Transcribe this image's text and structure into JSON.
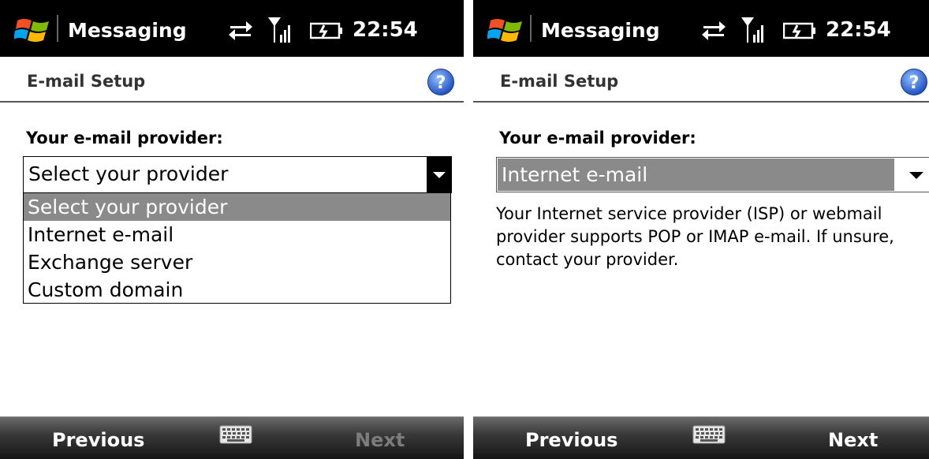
{
  "screens": [
    {
      "status_bar": {
        "app_title": "Messaging",
        "time": "22:54"
      },
      "header": {
        "title": "E-mail Setup"
      },
      "field_label": "Your e-mail provider:",
      "dropdown": {
        "value": "Select your provider",
        "expanded": true,
        "options": [
          "Select your provider",
          "Internet e-mail",
          "Exchange server",
          "Custom domain"
        ],
        "highlighted_option": "Select your provider"
      },
      "softkeys": {
        "left": "Previous",
        "right": "Next",
        "right_enabled": false
      }
    },
    {
      "status_bar": {
        "app_title": "Messaging",
        "time": "22:54"
      },
      "header": {
        "title": "E-mail Setup"
      },
      "field_label": "Your e-mail provider:",
      "dropdown": {
        "value": "Internet e-mail",
        "expanded": false
      },
      "description": "Your Internet service provider (ISP) or webmail provider supports POP or IMAP e-mail.  If unsure, contact your provider.",
      "softkeys": {
        "left": "Previous",
        "right": "Next",
        "right_enabled": true
      }
    }
  ],
  "colors": {
    "status_bar_bg": "#000000",
    "selection_gray": "#8a8a8a",
    "disabled_text": "#7c7c7c",
    "help_blue": "#1f5fd6"
  },
  "icons": [
    "windows-logo-icon",
    "sync-arrows-icon",
    "signal-icon",
    "battery-icon",
    "help-icon",
    "chevron-down-icon",
    "keyboard-icon"
  ]
}
